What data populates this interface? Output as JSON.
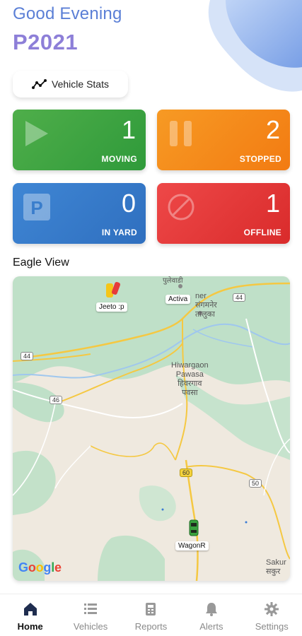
{
  "header": {
    "greeting": "Good Evening",
    "user_id": "P2021",
    "stats_button_label": "Vehicle Stats"
  },
  "cards": [
    {
      "count": "1",
      "label": "MOVING",
      "icon": "play-icon",
      "color": "#3aa23f"
    },
    {
      "count": "2",
      "label": "STOPPED",
      "icon": "pause-icon",
      "color": "#f5871a"
    },
    {
      "count": "0",
      "label": "IN YARD",
      "icon": "parking-icon",
      "color": "#3779c9"
    },
    {
      "count": "1",
      "label": "OFFLINE",
      "icon": "blocked-icon",
      "color": "#e33a3a"
    }
  ],
  "map": {
    "title": "Eagle View",
    "vehicles": [
      {
        "label": "Jeeto :p"
      },
      {
        "label": "Activa"
      },
      {
        "label": "WagonR"
      }
    ],
    "places": {
      "top_town": "पुलेवाडी",
      "top_region": "ner\nसंगमनेर\nतालुका",
      "center_town": "Hiwargaon\nPawasa\nहिवरगाव\nपवसा",
      "corner_town": "Sakur\nसकुर"
    },
    "roads": [
      "44",
      "44",
      "46",
      "60",
      "50"
    ],
    "attribution": "Google"
  },
  "nav": [
    {
      "label": "Home",
      "icon": "home-icon",
      "active": true
    },
    {
      "label": "Vehicles",
      "icon": "list-icon",
      "active": false
    },
    {
      "label": "Reports",
      "icon": "report-icon",
      "active": false
    },
    {
      "label": "Alerts",
      "icon": "bell-icon",
      "active": false
    },
    {
      "label": "Settings",
      "icon": "gear-icon",
      "active": false
    }
  ],
  "colors": {
    "greeting": "#5b7fd6",
    "user_id": "#8d7fd8",
    "blob": "#7fa6ea"
  }
}
